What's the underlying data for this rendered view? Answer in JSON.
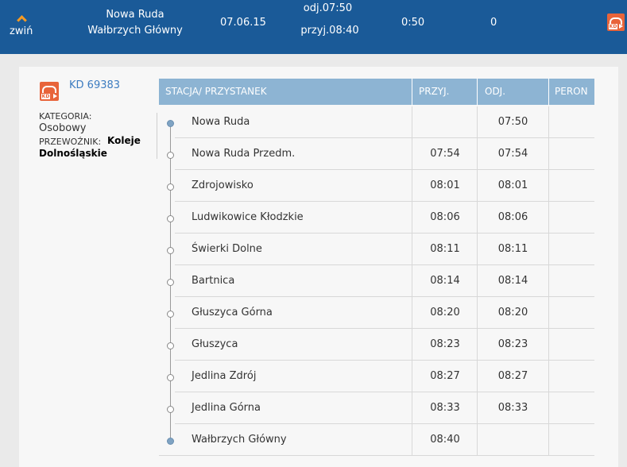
{
  "header": {
    "collapse_label": "zwiń",
    "from": "Nowa Ruda",
    "to": "Wałbrzych Główny",
    "date": "07.06.15",
    "departure": "odj.07:50",
    "arrival": "przyj.08:40",
    "duration": "0:50",
    "changes": "0",
    "logo_text": "KD"
  },
  "train": {
    "logo_text": "KD",
    "number": "KD 69383",
    "category_label": "KATEGORIA:",
    "category_value": "Osobowy",
    "carrier_label": "PRZEWOŹNIK:",
    "carrier_value": "Koleje Dolnośląskie"
  },
  "table": {
    "columns": [
      "STACJA/ PRZYSTANEK",
      "PRZYJ.",
      "ODJ.",
      "PERON"
    ],
    "rows": [
      {
        "station": "Nowa Ruda",
        "arrival": "",
        "departure": "07:50",
        "platform": ""
      },
      {
        "station": "Nowa Ruda Przedm.",
        "arrival": "07:54",
        "departure": "07:54",
        "platform": ""
      },
      {
        "station": "Zdrojowisko",
        "arrival": "08:01",
        "departure": "08:01",
        "platform": ""
      },
      {
        "station": "Ludwikowice Kłodzkie",
        "arrival": "08:06",
        "departure": "08:06",
        "platform": ""
      },
      {
        "station": "Świerki Dolne",
        "arrival": "08:11",
        "departure": "08:11",
        "platform": ""
      },
      {
        "station": "Bartnica",
        "arrival": "08:14",
        "departure": "08:14",
        "platform": ""
      },
      {
        "station": "Głuszyca Górna",
        "arrival": "08:20",
        "departure": "08:20",
        "platform": ""
      },
      {
        "station": "Głuszyca",
        "arrival": "08:23",
        "departure": "08:23",
        "platform": ""
      },
      {
        "station": "Jedlina Zdrój",
        "arrival": "08:27",
        "departure": "08:27",
        "platform": ""
      },
      {
        "station": "Jedlina Górna",
        "arrival": "08:33",
        "departure": "08:33",
        "platform": ""
      },
      {
        "station": "Wałbrzych Główny",
        "arrival": "08:40",
        "departure": "",
        "platform": ""
      }
    ]
  },
  "colors": {
    "header_bg": "#1a5a98",
    "accent_orange": "#f59a23",
    "logo_red": "#e8643a",
    "table_header_bg": "#8db4d3",
    "link_blue": "#3d7cc0"
  }
}
